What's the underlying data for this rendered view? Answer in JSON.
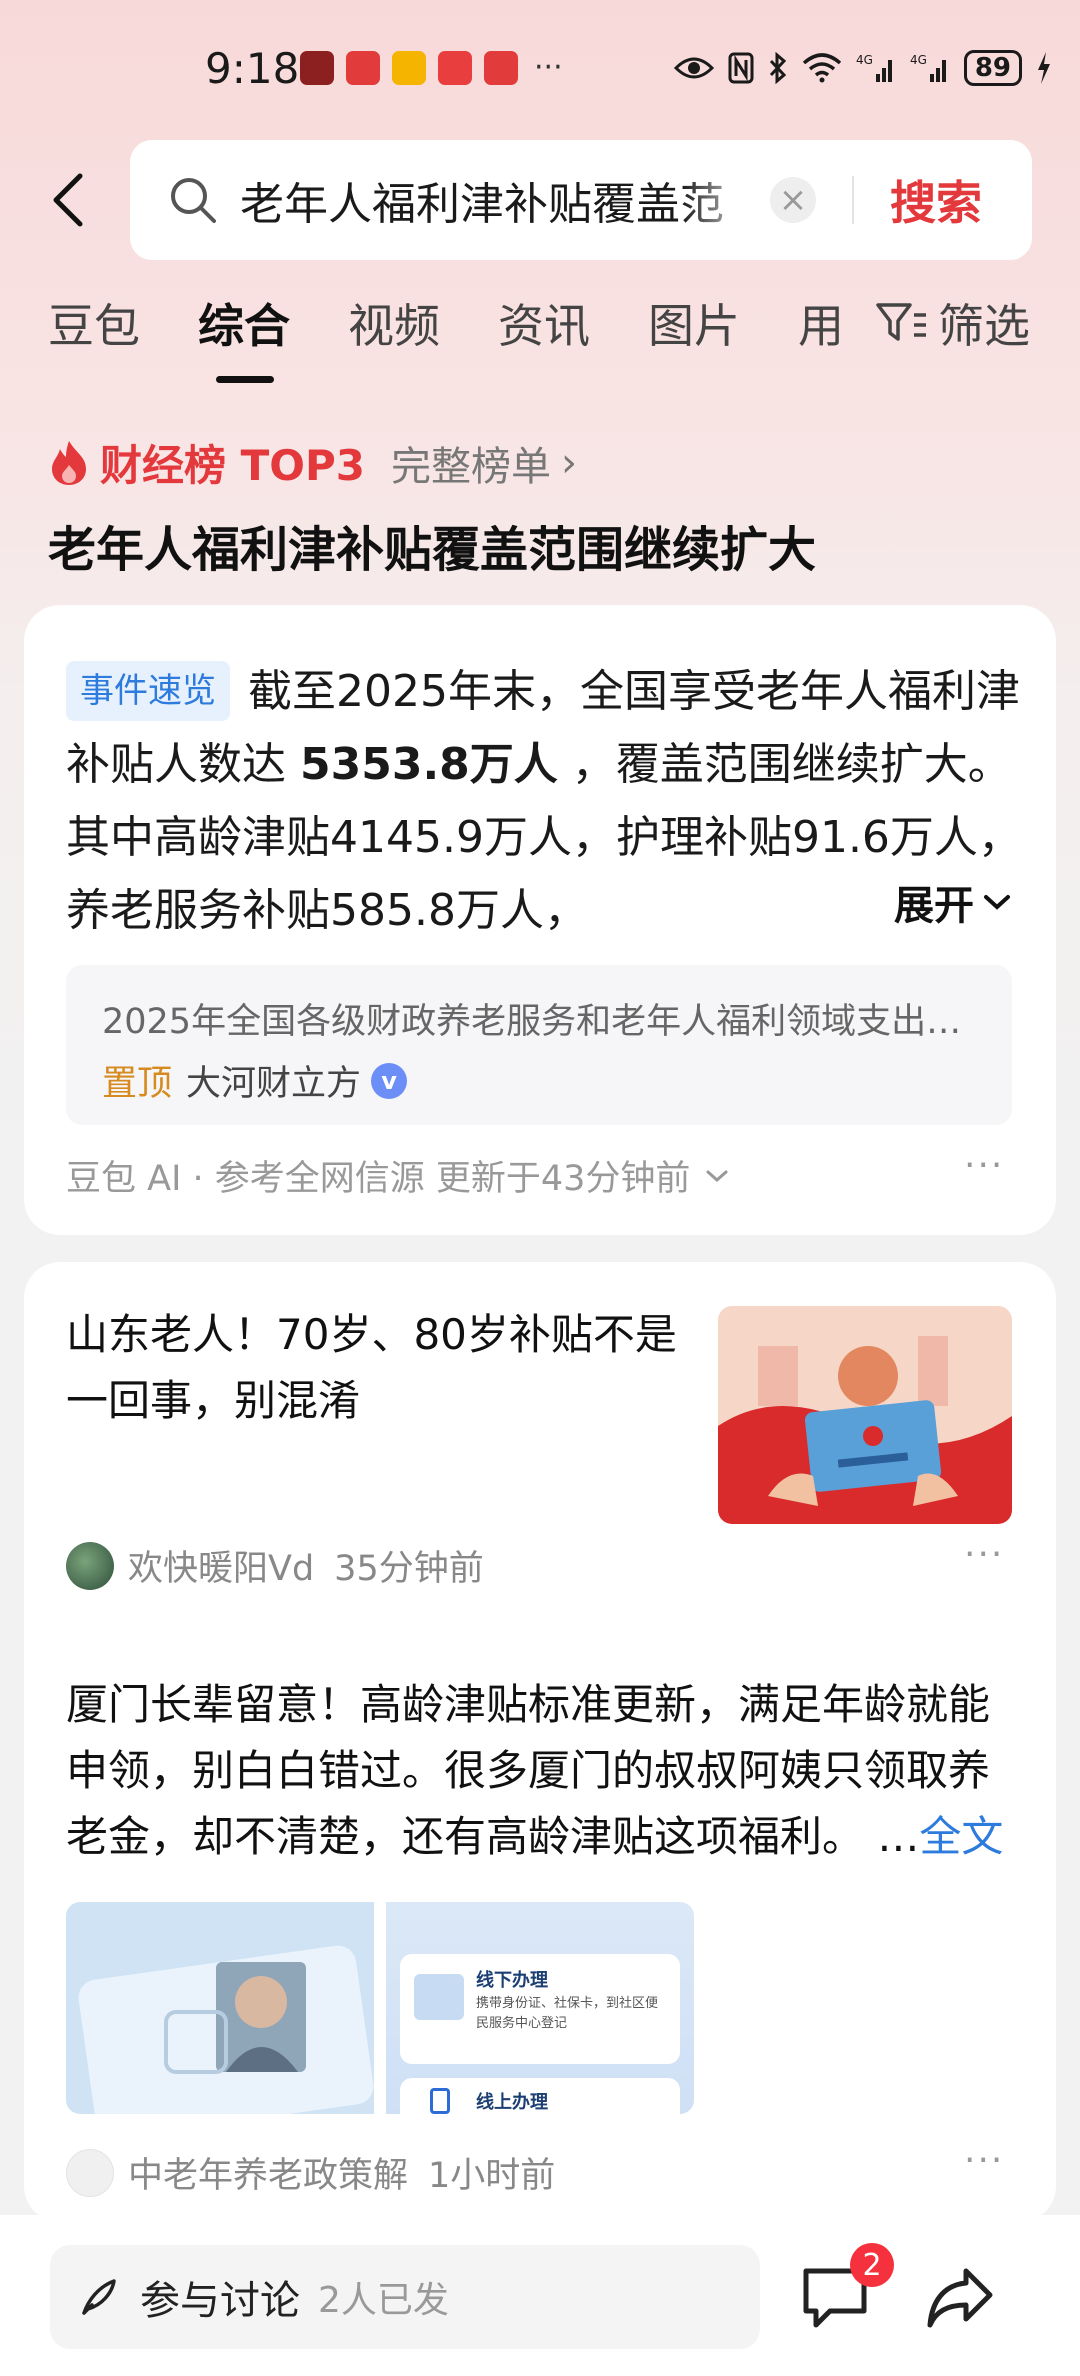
{
  "status_bar": {
    "time": "9:18",
    "more": "···",
    "battery": "89"
  },
  "search": {
    "query": "老年人福利津补贴覆盖范",
    "search_label": "搜索"
  },
  "tabs": [
    "豆包",
    "综合",
    "视频",
    "资讯",
    "图片",
    "用"
  ],
  "active_tab": "综合",
  "filter_label": "筛选",
  "ranking": {
    "title": "财经榜 TOP3",
    "link": "完整榜单",
    "topic": "老年人福利津补贴覆盖范围继续扩大"
  },
  "summary_card": {
    "badge": "事件速览",
    "text_before": "截至2025年末，全国享受老年人福利津补贴人数达 ",
    "highlight": "5353.8万人",
    "text_after": " ，覆盖范围继续扩大。其中高龄津贴4145.9万人，护理补贴91.6万人，养老服务补贴585.8万人，",
    "expand_label": "展开",
    "source_text": "2025年全国各级财政养老服务和老年人福利领域支出…",
    "pin_label": "置顶",
    "source_name": "大河财立方",
    "footer": "豆包 AI · 参考全网信源  更新于43分钟前"
  },
  "article1": {
    "title": "山东老人！70岁、80岁补贴不是一回事，别混淆",
    "author": "欢快暖阳Vd",
    "time": "35分钟前"
  },
  "article2": {
    "text": "厦门长辈留意！高龄津贴标准更新，满足年龄就能申领，别白白错过。很多厦门的叔叔阿姨只领取养老金，却不清楚，还有高龄津贴这项福利。 ",
    "ellipsis": "…",
    "full_label": "全文",
    "img2_item1_title": "线下办理",
    "img2_item1_desc": "携带身份证、社保卡，到社区便民服务中心登记",
    "img2_item2_title": "线上办理",
    "author": "中老年养老政策解",
    "time": "1小时前"
  },
  "bottom_bar": {
    "discuss_label": "参与讨论",
    "discuss_count": "2人已发",
    "comment_badge": "2"
  },
  "colors": {
    "accent_red": "#e4393c",
    "link_blue": "#2d7bdc",
    "pin_orange": "#d68a1f"
  }
}
